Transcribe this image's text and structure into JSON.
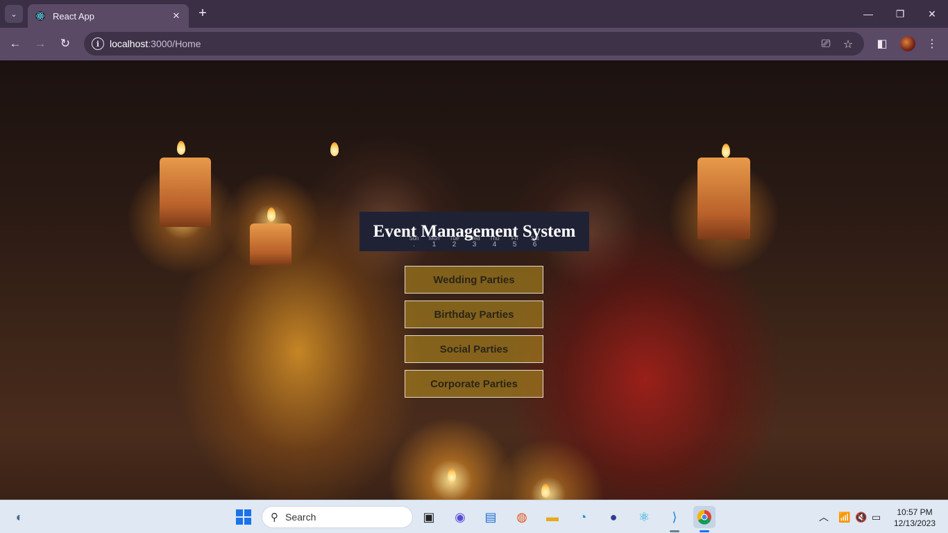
{
  "browser": {
    "tab_title": "React App",
    "url_host": "localhost",
    "url_path": ":3000/Home"
  },
  "page": {
    "heading": "Event Management System",
    "calendar_days": [
      {
        "label": "Sun",
        "num": "."
      },
      {
        "label": "Mon",
        "num": "1"
      },
      {
        "label": "Tue",
        "num": "2"
      },
      {
        "label": "Wed",
        "num": "3"
      },
      {
        "label": "Thu",
        "num": "4"
      },
      {
        "label": "Fri",
        "num": "5"
      },
      {
        "label": "Sat",
        "num": "6"
      }
    ],
    "menu": [
      "Wedding Parties",
      "Birthday Parties",
      "Social Parties",
      "Corporate Parties"
    ]
  },
  "taskbar": {
    "search_placeholder": "Search",
    "time": "10:57 PM",
    "date": "12/13/2023"
  },
  "colors": {
    "header_bg": "#1f2235",
    "button_fill": "#b0881e",
    "browser_frame": "#3b2f45"
  }
}
